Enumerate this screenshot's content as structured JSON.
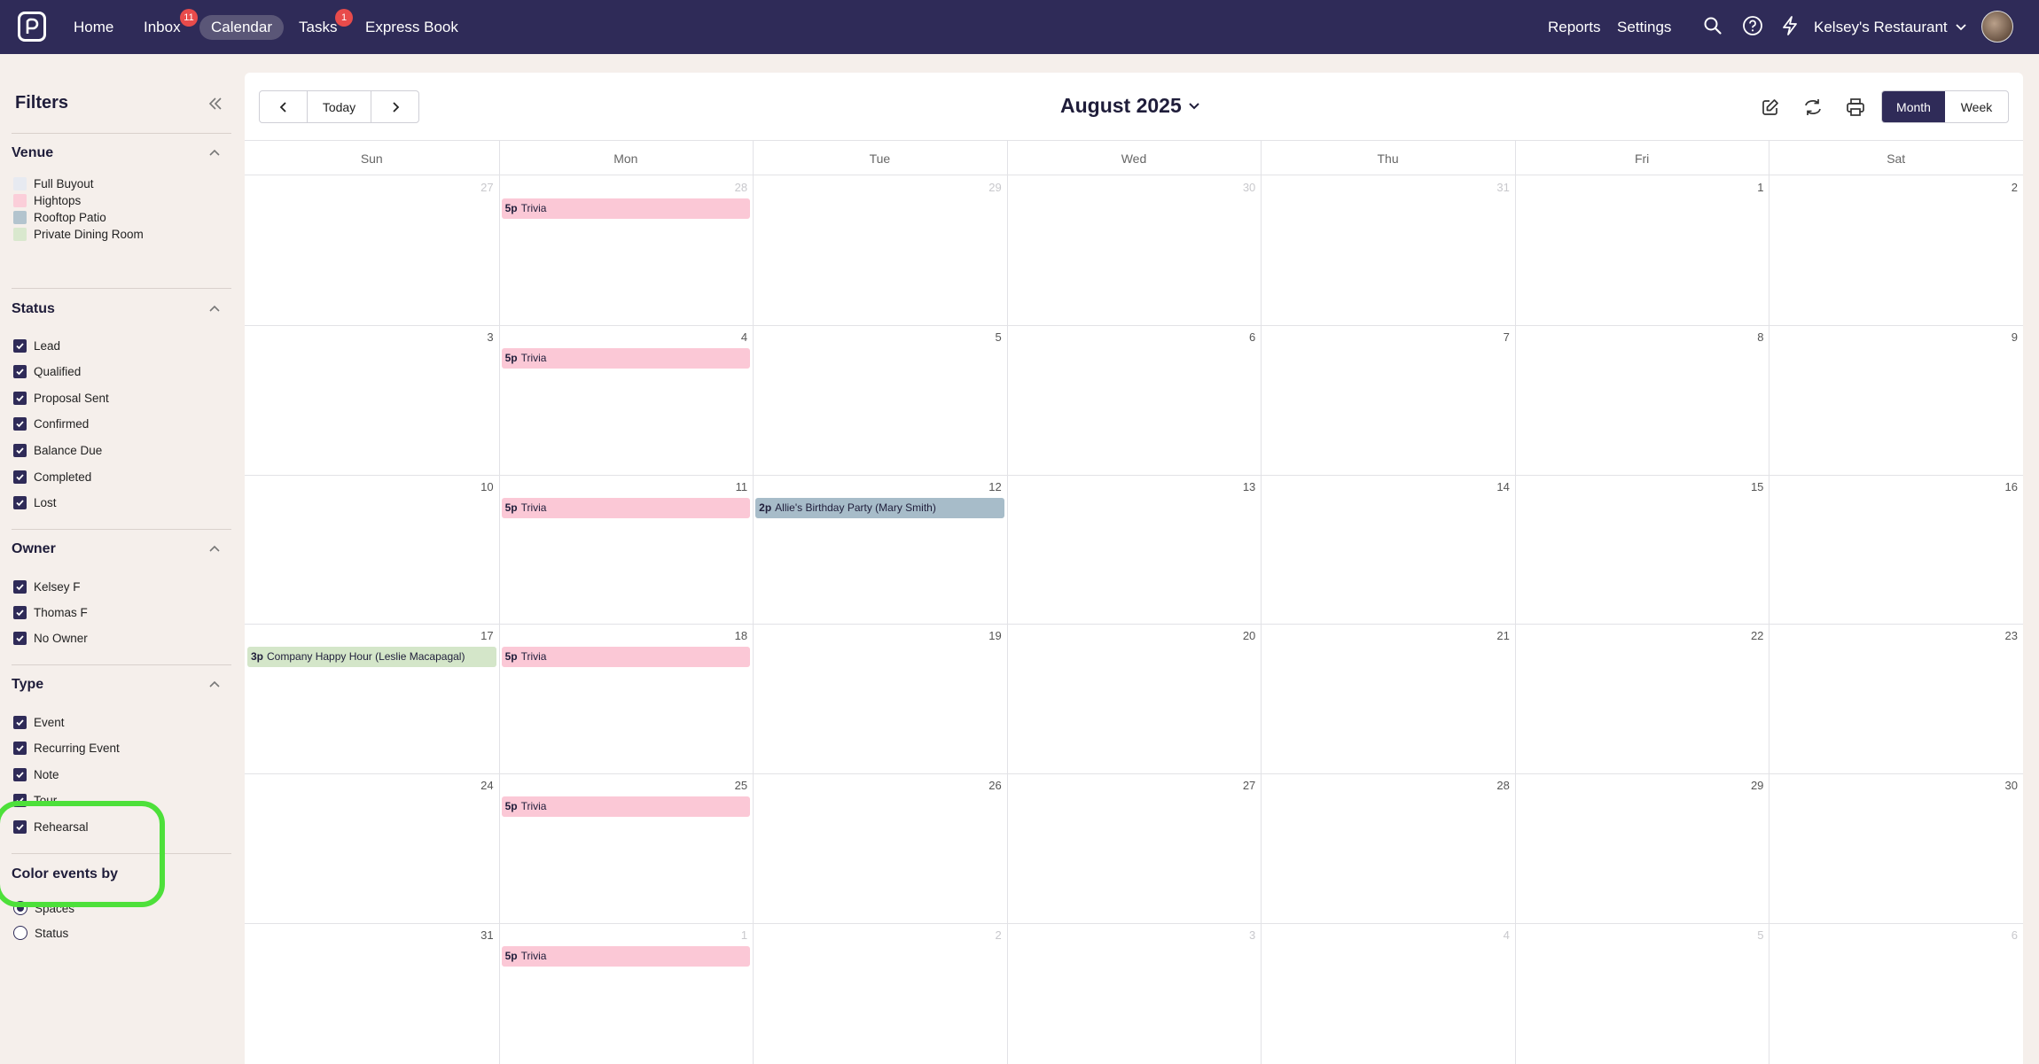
{
  "nav": {
    "items": [
      {
        "label": "Home"
      },
      {
        "label": "Inbox",
        "badge": "11"
      },
      {
        "label": "Calendar",
        "active": true
      },
      {
        "label": "Tasks",
        "badge": "1"
      },
      {
        "label": "Express Book"
      }
    ],
    "reports": "Reports",
    "settings": "Settings",
    "account": "Kelsey's Restaurant",
    "icons": [
      "search-icon",
      "help-icon",
      "lightning-icon",
      "chevron-down-icon"
    ]
  },
  "sidebar": {
    "title": "Filters",
    "venue": {
      "heading": "Venue",
      "items": [
        {
          "label": "Full Buyout",
          "color": "#e4e9f2"
        },
        {
          "label": "Hightops",
          "color": "#fbc8d6"
        },
        {
          "label": "Rooftop Patio",
          "color": "#a7bcc9"
        },
        {
          "label": "Private Dining Room",
          "color": "#d4e6c9"
        }
      ]
    },
    "status": {
      "heading": "Status",
      "items": [
        "Lead",
        "Qualified",
        "Proposal Sent",
        "Confirmed",
        "Balance Due",
        "Completed",
        "Lost"
      ]
    },
    "owner": {
      "heading": "Owner",
      "items": [
        "Kelsey F",
        "Thomas F",
        "No Owner"
      ]
    },
    "type": {
      "heading": "Type",
      "items": [
        "Event",
        "Recurring Event",
        "Note",
        "Tour",
        "Rehearsal"
      ]
    },
    "color_by": {
      "heading": "Color events by",
      "options": [
        {
          "label": "Spaces",
          "selected": true
        },
        {
          "label": "Status",
          "selected": false
        }
      ]
    }
  },
  "calendar": {
    "today_label": "Today",
    "month_title": "August 2025",
    "views": {
      "month": "Month",
      "week": "Week",
      "active": "Month"
    },
    "weekdays": [
      "Sun",
      "Mon",
      "Tue",
      "Wed",
      "Thu",
      "Fri",
      "Sat"
    ],
    "weeks": [
      [
        {
          "d": "27",
          "m": true
        },
        {
          "d": "28",
          "m": true
        },
        {
          "d": "29",
          "m": true
        },
        {
          "d": "30",
          "m": true
        },
        {
          "d": "31",
          "m": true
        },
        {
          "d": "1"
        },
        {
          "d": "2"
        }
      ],
      [
        {
          "d": "3"
        },
        {
          "d": "4"
        },
        {
          "d": "5"
        },
        {
          "d": "6"
        },
        {
          "d": "7"
        },
        {
          "d": "8"
        },
        {
          "d": "9"
        }
      ],
      [
        {
          "d": "10"
        },
        {
          "d": "11"
        },
        {
          "d": "12"
        },
        {
          "d": "13"
        },
        {
          "d": "14"
        },
        {
          "d": "15"
        },
        {
          "d": "16"
        }
      ],
      [
        {
          "d": "17"
        },
        {
          "d": "18"
        },
        {
          "d": "19"
        },
        {
          "d": "20"
        },
        {
          "d": "21"
        },
        {
          "d": "22"
        },
        {
          "d": "23"
        }
      ],
      [
        {
          "d": "24"
        },
        {
          "d": "25"
        },
        {
          "d": "26"
        },
        {
          "d": "27"
        },
        {
          "d": "28"
        },
        {
          "d": "29"
        },
        {
          "d": "30"
        }
      ],
      [
        {
          "d": "31"
        },
        {
          "d": "1",
          "m": true
        },
        {
          "d": "2",
          "m": true
        },
        {
          "d": "3",
          "m": true
        },
        {
          "d": "4",
          "m": true
        },
        {
          "d": "5",
          "m": true
        },
        {
          "d": "6",
          "m": true
        }
      ]
    ],
    "events": [
      {
        "week": 0,
        "day": 1,
        "time": "5p",
        "title": "Trivia",
        "color": "pink"
      },
      {
        "week": 1,
        "day": 1,
        "time": "5p",
        "title": "Trivia",
        "color": "pink"
      },
      {
        "week": 2,
        "day": 1,
        "time": "5p",
        "title": "Trivia",
        "color": "pink"
      },
      {
        "week": 2,
        "day": 2,
        "time": "2p",
        "title": "Allie's Birthday Party (Mary Smith)",
        "color": "blue"
      },
      {
        "week": 3,
        "day": 0,
        "time": "3p",
        "title": "Company Happy Hour (Leslie Macapagal)",
        "color": "green"
      },
      {
        "week": 3,
        "day": 1,
        "time": "5p",
        "title": "Trivia",
        "color": "pink"
      },
      {
        "week": 4,
        "day": 1,
        "time": "5p",
        "title": "Trivia",
        "color": "pink"
      },
      {
        "week": 5,
        "day": 1,
        "time": "5p",
        "title": "Trivia",
        "color": "pink"
      }
    ],
    "toolbar_icons": [
      "edit-icon",
      "sync-icon",
      "print-icon"
    ]
  }
}
